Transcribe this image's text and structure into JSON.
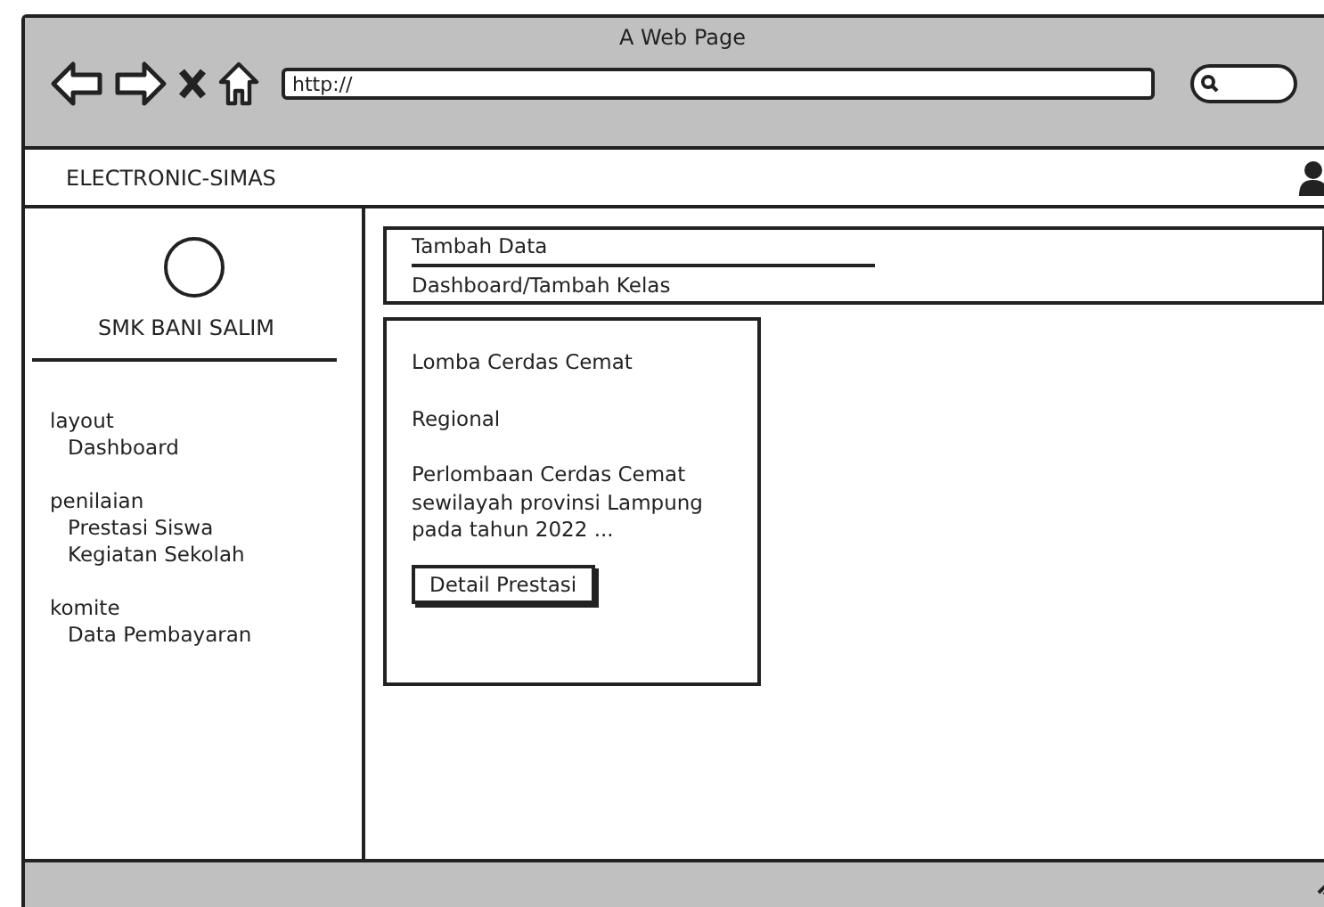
{
  "window": {
    "title": "A Web Page",
    "url": "http://"
  },
  "header": {
    "brand": "ELECTRONIC-SIMAS"
  },
  "sidebar": {
    "school": "SMK BANI SALIM",
    "groups": [
      {
        "label": "layout",
        "children": [
          {
            "label": "Dashboard"
          }
        ]
      },
      {
        "label": "penilaian",
        "children": [
          {
            "label": "Prestasi Siswa"
          },
          {
            "label": "Kegiatan Sekolah"
          }
        ]
      },
      {
        "label": "komite",
        "children": [
          {
            "label": "Data Pembayaran"
          }
        ]
      }
    ]
  },
  "content": {
    "title": "Tambah Data",
    "breadcrumb": "Dashboard/Tambah Kelas",
    "card": {
      "title": "Lomba Cerdas Cemat",
      "category": "Regional",
      "description": "Perlombaan Cerdas Cemat sewilayah provinsi Lampung pada tahun 2022 ...",
      "button": "Detail Prestasi"
    }
  }
}
